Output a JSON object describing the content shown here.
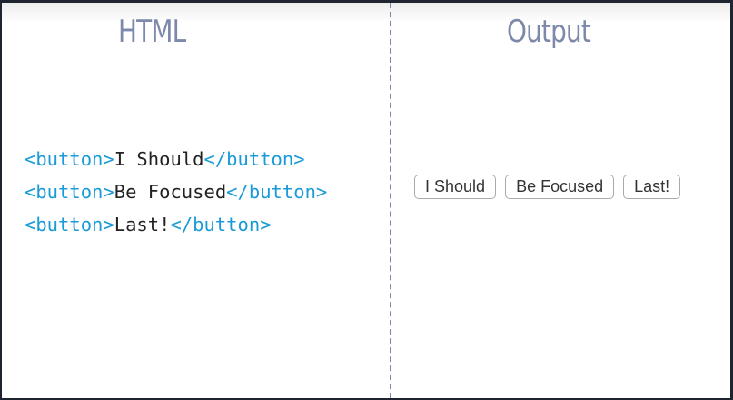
{
  "headers": {
    "left": "HTML",
    "right": "Output"
  },
  "code_lines": [
    {
      "open": "<button>",
      "text": "I Should",
      "close": "</button>"
    },
    {
      "open": "<button>",
      "text": "Be Focused",
      "close": "</button>"
    },
    {
      "open": "<button>",
      "text": "Last!",
      "close": "</button>"
    }
  ],
  "output_buttons": [
    "I Should",
    "Be Focused",
    "Last!"
  ],
  "colors": {
    "tag": "#1a9bd7",
    "heading": "#7d89ab"
  }
}
